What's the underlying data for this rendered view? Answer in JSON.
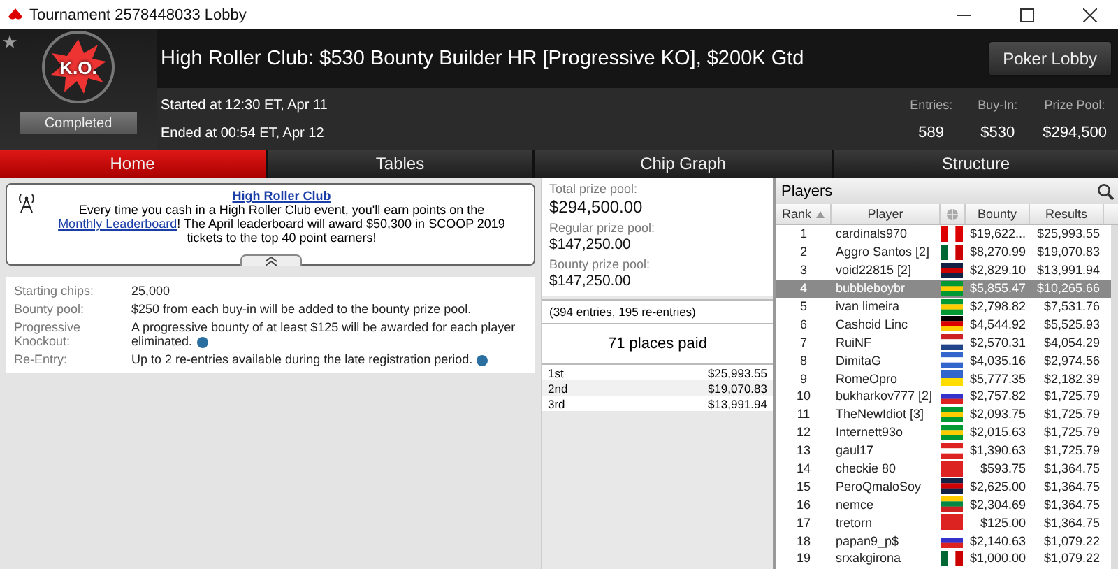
{
  "window": {
    "title": "Tournament 2578448033 Lobby"
  },
  "header": {
    "title": "High Roller Club: $530 Bounty Builder HR [Progressive KO], $200K Gtd",
    "logo_text": "K.O.",
    "started": "Started at 12:30 ET, Apr 11",
    "ended": "Ended at 00:54 ET, Apr 12",
    "status": "Completed",
    "button": "Poker Lobby",
    "stats": [
      {
        "label": "Entries:",
        "value": "589"
      },
      {
        "label": "Buy-In:",
        "value": "$530"
      },
      {
        "label": "Prize Pool:",
        "value": "$294,500"
      }
    ]
  },
  "tabs": [
    {
      "label": "Home",
      "selected": true
    },
    {
      "label": "Tables",
      "selected": false
    },
    {
      "label": "Chip Graph",
      "selected": false
    },
    {
      "label": "Structure",
      "selected": false
    }
  ],
  "notice": {
    "heading": "High Roller Club",
    "text_before": "Every time you cash in a High Roller Club event, you'll earn points on the",
    "link": "Monthly Leaderboard",
    "text_after": "! The April leaderboard will award $50,300 in SCOOP 2019 tickets to the top 40 point earners!",
    "expanded": true
  },
  "details": [
    {
      "label": "Starting chips:",
      "value": "25,000",
      "info": false
    },
    {
      "label": "Bounty pool:",
      "value": "$250 from each buy-in will be added to the bounty prize pool.",
      "info": false
    },
    {
      "label": "Progressive Knockout:",
      "value": "A progressive bounty of at least $125 will be awarded for each player eliminated.",
      "info": true
    },
    {
      "label": "Re-Entry:",
      "value": "Up to 2 re-entries available during the late registration period.",
      "info": true
    }
  ],
  "prize": {
    "pools": [
      {
        "label": "Total prize pool:",
        "value": "$294,500.00"
      },
      {
        "label": "Regular prize pool:",
        "value": "$147,250.00"
      },
      {
        "label": "Bounty prize pool:",
        "value": "$147,250.00"
      }
    ],
    "entries_note": "(394 entries, 195 re-entries)",
    "places_paid": "71 places paid",
    "payouts": [
      {
        "place": "1st",
        "amount": "$25,993.55"
      },
      {
        "place": "2nd",
        "amount": "$19,070.83"
      },
      {
        "place": "3rd",
        "amount": "$13,991.94"
      }
    ]
  },
  "players": {
    "title": "Players",
    "columns": [
      "Rank",
      "Player",
      "Bounty",
      "Results"
    ],
    "rows": [
      {
        "rank": "1",
        "player": "cardinals970",
        "kind": "ca",
        "bounty": "$19,622...",
        "results": "$25,993.55",
        "selected": false
      },
      {
        "rank": "2",
        "player": "Aggro Santos [2]",
        "kind": "mx",
        "bounty": "$8,270.99",
        "results": "$19,070.83",
        "selected": false
      },
      {
        "rank": "3",
        "player": "void22815 [2]",
        "kind": "gb",
        "bounty": "$2,829.10",
        "results": "$13,991.94",
        "selected": false
      },
      {
        "rank": "4",
        "player": "bubbleboybr",
        "kind": "br",
        "bounty": "$5,855.47",
        "results": "$10,265.66",
        "selected": true
      },
      {
        "rank": "5",
        "player": "ivan limeira",
        "kind": "br",
        "bounty": "$2,798.82",
        "results": "$7,531.76",
        "selected": false
      },
      {
        "rank": "6",
        "player": "Cashcid Linc",
        "kind": "de",
        "bounty": "$4,544.92",
        "results": "$5,525.93",
        "selected": false
      },
      {
        "rank": "7",
        "player": "RuiNF",
        "kind": "nl",
        "bounty": "$2,570.31",
        "results": "$4,054.29",
        "selected": false
      },
      {
        "rank": "8",
        "player": "DimitaG",
        "kind": "gr",
        "bounty": "$4,035.16",
        "results": "$2,974.56",
        "selected": false
      },
      {
        "rank": "9",
        "player": "RomeOpro",
        "kind": "ua",
        "bounty": "$5,777.35",
        "results": "$2,182.39",
        "selected": false
      },
      {
        "rank": "10",
        "player": "bukharkov777 [2]",
        "kind": "ru",
        "bounty": "$2,757.82",
        "results": "$1,725.79",
        "selected": false
      },
      {
        "rank": "11",
        "player": "TheNewIdiot [3]",
        "kind": "br",
        "bounty": "$2,093.75",
        "results": "$1,725.79",
        "selected": false
      },
      {
        "rank": "12",
        "player": "Internett93o",
        "kind": "br",
        "bounty": "$2,015.63",
        "results": "$1,725.79",
        "selected": false
      },
      {
        "rank": "13",
        "player": "gaul17",
        "kind": "at",
        "bounty": "$1,390.63",
        "results": "$1,725.79",
        "selected": false
      },
      {
        "rank": "14",
        "player": "checkie 80",
        "kind": "ch",
        "bounty": "$593.75",
        "results": "$1,364.75",
        "selected": false
      },
      {
        "rank": "15",
        "player": "PeroQmaloSoy",
        "kind": "gb",
        "bounty": "$2,625.00",
        "results": "$1,364.75",
        "selected": false
      },
      {
        "rank": "16",
        "player": "nemce",
        "kind": "lt",
        "bounty": "$2,304.69",
        "results": "$1,364.75",
        "selected": false
      },
      {
        "rank": "17",
        "player": "tretorn",
        "kind": "ch",
        "bounty": "$125.00",
        "results": "$1,364.75",
        "selected": false
      },
      {
        "rank": "18",
        "player": "papan9_p$",
        "kind": "ru",
        "bounty": "$2,140.63",
        "results": "$1,079.22",
        "selected": false
      },
      {
        "rank": "19",
        "player": "srxakgirona",
        "kind": "mx",
        "bounty": "$1,000.00",
        "results": "$1,079.22",
        "selected": false
      }
    ]
  }
}
